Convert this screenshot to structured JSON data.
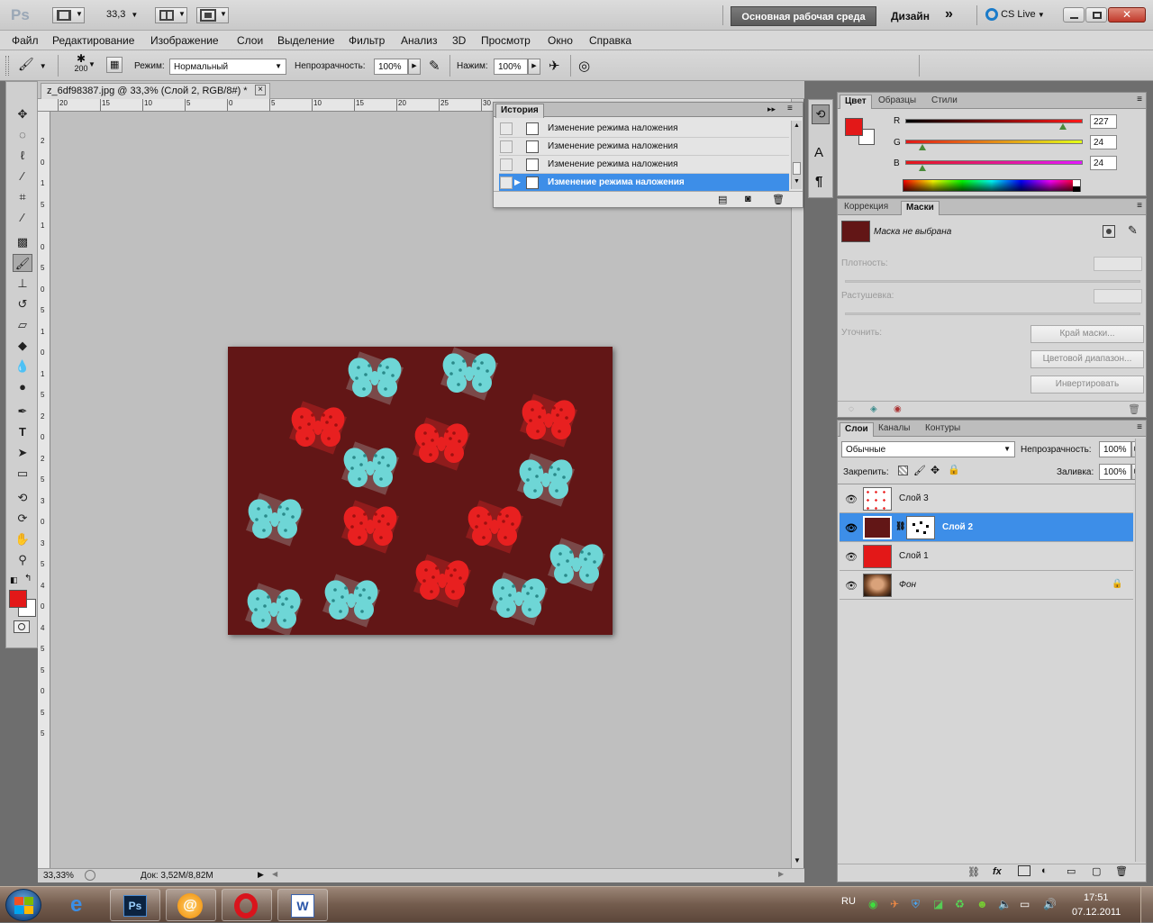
{
  "app": {
    "logo": "Ps",
    "zoom_field": "33,3",
    "workspace_active": "Основная рабочая среда",
    "workspace_alt": "Дизайн",
    "expand_glyph": "»",
    "cs_live": "CS Live"
  },
  "menu": [
    "Файл",
    "Редактирование",
    "Изображение",
    "Слои",
    "Выделение",
    "Фильтр",
    "Анализ",
    "3D",
    "Просмотр",
    "Окно",
    "Справка"
  ],
  "options": {
    "brush_size": "200",
    "mode_label": "Режим:",
    "mode_value": "Нормальный",
    "opacity_label": "Непрозрачность:",
    "opacity_value": "100%",
    "flow_label": "Нажим:",
    "flow_value": "100%"
  },
  "document": {
    "tab_title": "z_6df98387.jpg @ 33,3% (Слой 2, RGB/8#) *",
    "close_glyph": "×",
    "ruler_top": [
      "20",
      "15",
      "10",
      "5",
      "0",
      "5",
      "10",
      "15",
      "20",
      "25",
      "30"
    ],
    "ruler_left": [
      "2",
      "0",
      "1",
      "5",
      "1",
      "0",
      "5",
      "0",
      "5",
      "1",
      "0",
      "1",
      "5",
      "2",
      "0",
      "2",
      "5",
      "3",
      "0",
      "3",
      "5",
      "4",
      "0",
      "4",
      "5",
      "5",
      "0",
      "5",
      "5"
    ],
    "status_zoom": "33,33%",
    "status_doc": "Док: 3,52M/8,82M",
    "bg_color": "#621616"
  },
  "history": {
    "title": "История",
    "items": [
      "Изменение режима наложения",
      "Изменение режима наложения",
      "Изменение режима наложения",
      "Изменение режима наложения"
    ],
    "selected_index": 3
  },
  "color_panel": {
    "tabs": [
      "Цвет",
      "Образцы",
      "Стили"
    ],
    "r_label": "R",
    "g_label": "G",
    "b_label": "B",
    "r": "227",
    "g": "24",
    "b": "24",
    "r_frac": 0.89,
    "g_frac": 0.094,
    "b_frac": 0.094,
    "fg": "#e31818",
    "bg": "#ffffff"
  },
  "masks_panel": {
    "tabs": [
      "Коррекция",
      "Маски"
    ],
    "status": "Маска не выбрана",
    "density_label": "Плотность:",
    "feather_label": "Растушевка:",
    "refine_label": "Уточнить:",
    "btn_edge": "Край маски...",
    "btn_color_range": "Цветовой диапазон...",
    "btn_invert": "Инвертировать",
    "thumb_color": "#621616"
  },
  "layers_panel": {
    "tabs": [
      "Слои",
      "Каналы",
      "Контуры"
    ],
    "blend_mode": "Обычные",
    "opacity_label": "Непрозрачность:",
    "opacity_value": "100%",
    "lock_label": "Закрепить:",
    "fill_label": "Заливка:",
    "fill_value": "100%",
    "layers": [
      {
        "name": "Слой 3",
        "selected": false
      },
      {
        "name": "Слой 2",
        "selected": true
      },
      {
        "name": "Слой 1",
        "selected": false
      },
      {
        "name": "Фон",
        "selected": false
      }
    ]
  },
  "taskbar": {
    "lang": "RU",
    "time": "17:51",
    "date": "07.12.2011",
    "ps_label": "Ps",
    "word_label": "W"
  }
}
